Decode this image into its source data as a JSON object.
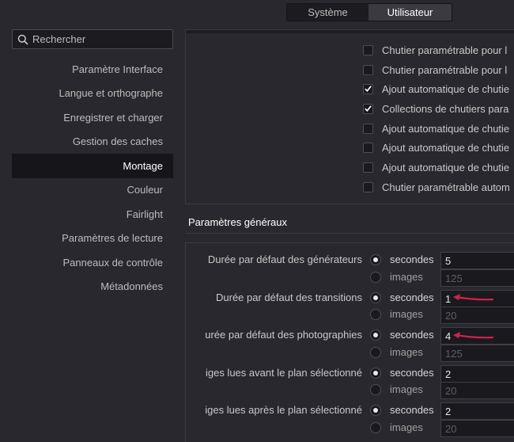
{
  "tabs": {
    "system": "Système",
    "user": "Utilisateur"
  },
  "search": {
    "placeholder": "Rechercher"
  },
  "sidebar": {
    "items": [
      {
        "label": "Paramètre Interface"
      },
      {
        "label": "Langue et orthographe"
      },
      {
        "label": "Enregistrer et charger"
      },
      {
        "label": "Gestion des caches"
      },
      {
        "label": "Montage"
      },
      {
        "label": "Couleur"
      },
      {
        "label": "Fairlight"
      },
      {
        "label": "Paramètres de lecture"
      },
      {
        "label": "Panneaux de contrôle"
      },
      {
        "label": "Métadonnées"
      }
    ],
    "active": "Montage"
  },
  "checkboxes": [
    {
      "label": "Chutier paramétrable pour l",
      "checked": false
    },
    {
      "label": "Chutier paramétrable pour l",
      "checked": false
    },
    {
      "label": "Ajout automatique de chutie",
      "checked": true
    },
    {
      "label": "Collections de chutiers para",
      "checked": true
    },
    {
      "label": "Ajout automatique de chutie",
      "checked": false
    },
    {
      "label": "Ajout automatique de chutie",
      "checked": false
    },
    {
      "label": "Ajout automatique de chutie",
      "checked": false
    },
    {
      "label": "Chutier paramétrable autom",
      "checked": false
    }
  ],
  "general": {
    "title": "Paramètres généraux",
    "rows": [
      {
        "label": "Durée par défaut des générateurs",
        "seconds_label": "secondes",
        "seconds": "5",
        "images_label": "images",
        "images": "125"
      },
      {
        "label": "Durée par défaut des transitions",
        "seconds_label": "secondes",
        "seconds": "1",
        "images_label": "images",
        "images": "20"
      },
      {
        "label": "urée par défaut des photographies",
        "seconds_label": "secondes",
        "seconds": "4",
        "images_label": "images",
        "images": "125"
      },
      {
        "label": "iges lues avant le plan sélectionné",
        "seconds_label": "secondes",
        "seconds": "2",
        "images_label": "images",
        "images": "20"
      },
      {
        "label": "iges lues après le plan sélectionné",
        "seconds_label": "secondes",
        "seconds": "2",
        "images_label": "images",
        "images": "20"
      }
    ]
  },
  "colors": {
    "background": "#28282e",
    "annotation_arrow": "#d0224c",
    "active_item": "#16161a"
  }
}
